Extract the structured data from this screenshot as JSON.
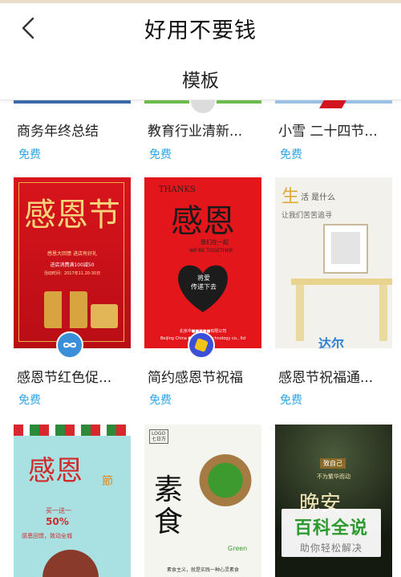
{
  "header": {
    "title": "好用不要钱",
    "back_icon": "chevron-left-icon"
  },
  "section": {
    "label": "模板"
  },
  "templates": [
    {
      "title": "商务年终总结",
      "price": "免费"
    },
    {
      "title": "教育行业清新...",
      "price": "免费"
    },
    {
      "title": "小雪 二十四节...",
      "price": "免费"
    },
    {
      "title": "感恩节红色促...",
      "price": "免费",
      "thumb_text": {
        "main": "感恩节",
        "line1": "感恩大回馈 进店有好礼",
        "line2": "进店消费满100减50",
        "line3": "活动时间：2017年11.20-30日"
      }
    },
    {
      "title": "简约感恩节祝福",
      "price": "免费",
      "thumb_text": {
        "top": "THANKS",
        "main": "感恩",
        "sub1": "我们在一起",
        "sub2": "WE'RE TOGETHER",
        "heart": "将爱\n传递下去",
        "footer1": "北京中■■■■■有限公司",
        "footer2": "Beijing China ■■■■■ technology co., ltd"
      }
    },
    {
      "title": "感恩节祝福通...",
      "price": "免费",
      "thumb_text": {
        "big": "生",
        "rest": "活 是什么",
        "line": "让我们苦苦追寻",
        "brand": "达尔"
      }
    },
    {
      "title": "",
      "price": "",
      "thumb_text": {
        "main": "感恩",
        "side": "節",
        "l1": "买一送一",
        "l2": "50%",
        "l3": "感恩回馈，致动全城"
      }
    },
    {
      "title": "",
      "price": "",
      "thumb_text": {
        "logo": "LOGO\n七日万",
        "main": "素食",
        "small": "Green",
        "foot": "素食主义，就是实践一种心灵素食"
      }
    },
    {
      "title": "",
      "price": "",
      "thumb_text": {
        "badge": "致自己",
        "line": "不为繁华而动",
        "main": "晚安"
      }
    }
  ],
  "watermark": {
    "title": "百科全说",
    "subtitle": "助你轻松解决"
  },
  "colors": {
    "accent": "#2fa6e6",
    "watermark_green": "#2c9a2e"
  }
}
